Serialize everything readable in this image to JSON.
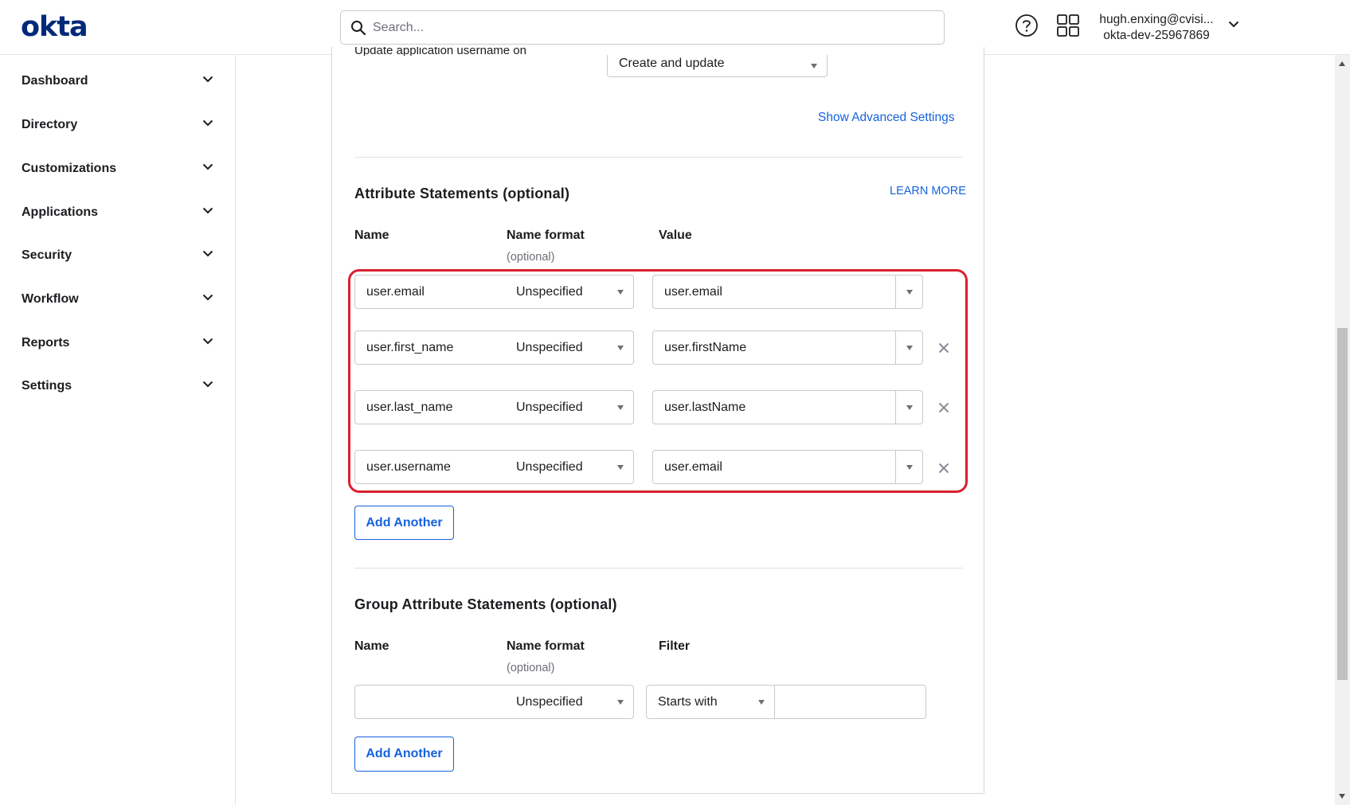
{
  "header": {
    "logo": "okta",
    "search_placeholder": "Search...",
    "user_email": "hugh.enxing@cvisi...",
    "org": "okta-dev-25967869"
  },
  "sidebar": {
    "items": [
      {
        "label": "Dashboard"
      },
      {
        "label": "Directory"
      },
      {
        "label": "Customizations"
      },
      {
        "label": "Applications"
      },
      {
        "label": "Security"
      },
      {
        "label": "Workflow"
      },
      {
        "label": "Reports"
      },
      {
        "label": "Settings"
      }
    ]
  },
  "main": {
    "update_username_label": "Update application username on",
    "update_username_value": "Create and update",
    "show_advanced": "Show Advanced Settings",
    "attr_section": {
      "title": "Attribute Statements (optional)",
      "learn_more": "LEARN MORE",
      "col_name": "Name",
      "col_format": "Name format",
      "col_format_sub": "(optional)",
      "col_value": "Value",
      "rows": [
        {
          "name": "user.email",
          "format": "Unspecified",
          "value": "user.email",
          "removable": false
        },
        {
          "name": "user.first_name",
          "format": "Unspecified",
          "value": "user.firstName",
          "removable": true
        },
        {
          "name": "user.last_name",
          "format": "Unspecified",
          "value": "user.lastName",
          "removable": true
        },
        {
          "name": "user.username",
          "format": "Unspecified",
          "value": "user.email",
          "removable": true
        }
      ],
      "add_button": "Add Another"
    },
    "group_section": {
      "title": "Group Attribute Statements (optional)",
      "col_name": "Name",
      "col_format": "Name format",
      "col_format_sub": "(optional)",
      "col_filter": "Filter",
      "row": {
        "name": "",
        "format": "Unspecified",
        "filter_type": "Starts with",
        "filter_value": ""
      },
      "add_button": "Add Another"
    }
  },
  "colors": {
    "brand": "#00297a",
    "link": "#1662dd",
    "highlight": "#d9202f"
  }
}
